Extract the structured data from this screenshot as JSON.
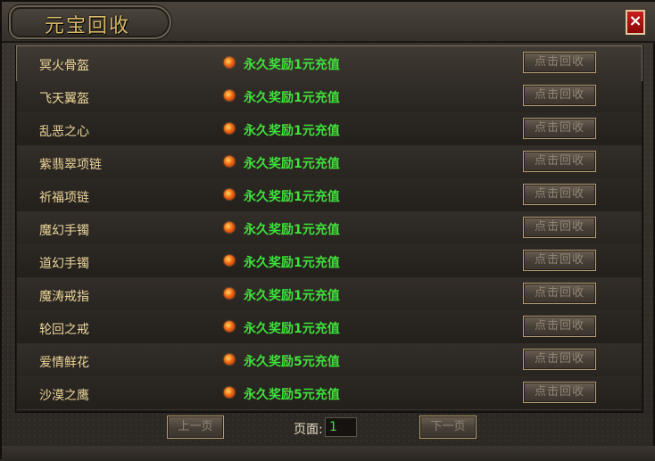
{
  "window": {
    "title": "元宝回收",
    "close_label": "×"
  },
  "items": [
    {
      "name": "冥火骨盔",
      "reward": "永久奖励1元充值",
      "button": "点击回收"
    },
    {
      "name": "飞天翼盔",
      "reward": "永久奖励1元充值",
      "button": "点击回收"
    },
    {
      "name": "乱恶之心",
      "reward": "永久奖励1元充值",
      "button": "点击回收"
    },
    {
      "name": "紫翡翠项链",
      "reward": "永久奖励1元充值",
      "button": "点击回收"
    },
    {
      "name": "祈福项链",
      "reward": "永久奖励1元充值",
      "button": "点击回收"
    },
    {
      "name": "魔幻手镯",
      "reward": "永久奖励1元充值",
      "button": "点击回收"
    },
    {
      "name": "道幻手镯",
      "reward": "永久奖励1元充值",
      "button": "点击回收"
    },
    {
      "name": "魔涛戒指",
      "reward": "永久奖励1元充值",
      "button": "点击回收"
    },
    {
      "name": "轮回之戒",
      "reward": "永久奖励1元充值",
      "button": "点击回收"
    },
    {
      "name": "爱情鲜花",
      "reward": "永久奖励5元充值",
      "button": "点击回收"
    },
    {
      "name": "沙漠之鹰",
      "reward": "永久奖励5元充值",
      "button": "点击回收"
    }
  ],
  "pager": {
    "prev_label": "上一页",
    "next_label": "下一页",
    "page_label": "页面:",
    "page_value": "1"
  },
  "colors": {
    "item_name": "#ecd69a",
    "reward": "#3fe13b",
    "close_button": "#c81d1d"
  }
}
